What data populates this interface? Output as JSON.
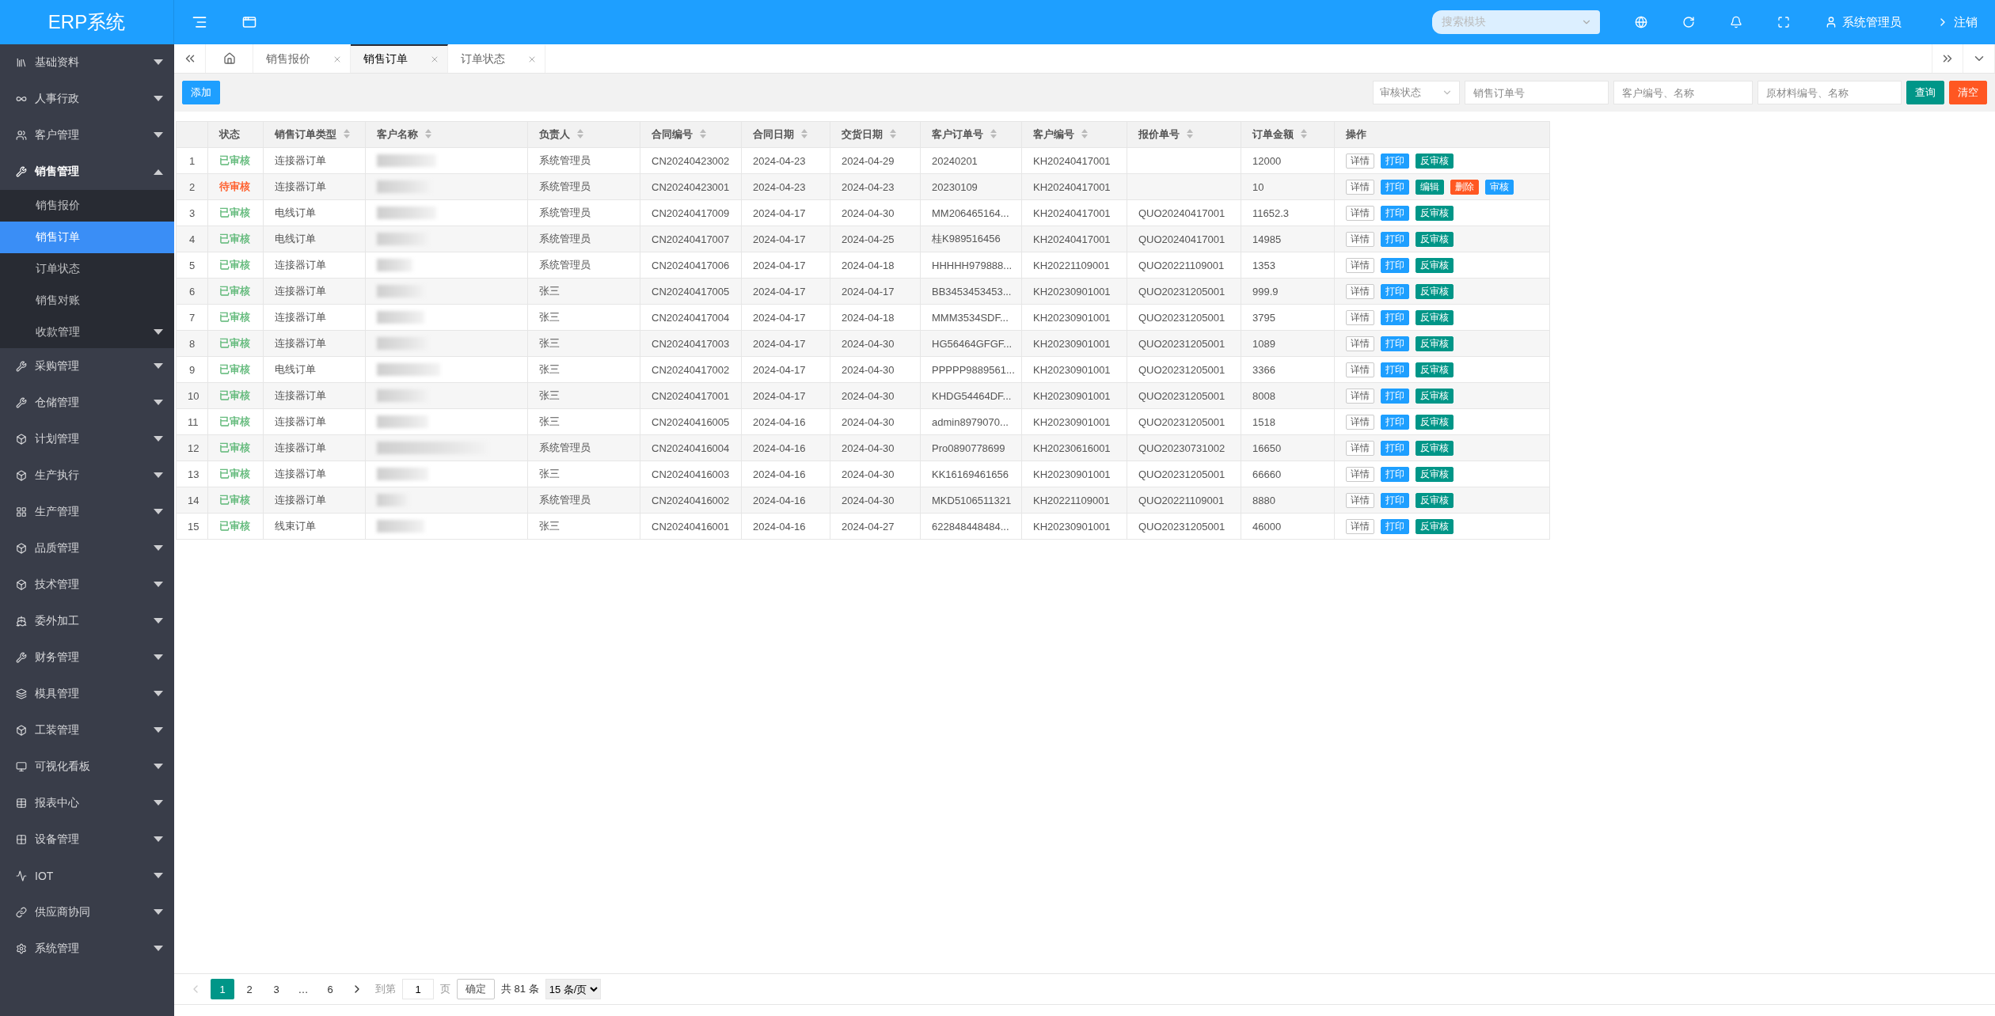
{
  "header": {
    "logo": "ERP系统",
    "search": {
      "placeholder": "搜索模块"
    },
    "user": "系统管理员",
    "logout": "注销"
  },
  "sidebar": {
    "items": [
      {
        "label": "基础资料",
        "expanded": false
      },
      {
        "label": "人事行政",
        "expanded": false
      },
      {
        "label": "客户管理",
        "expanded": false
      },
      {
        "label": "销售管理",
        "expanded": true,
        "children": [
          {
            "label": "销售报价",
            "selected": false
          },
          {
            "label": "销售订单",
            "selected": true
          },
          {
            "label": "订单状态",
            "selected": false
          },
          {
            "label": "销售对账",
            "selected": false
          },
          {
            "label": "收款管理",
            "selected": false,
            "expandable": true
          }
        ]
      },
      {
        "label": "采购管理",
        "expanded": false
      },
      {
        "label": "仓储管理",
        "expanded": false
      },
      {
        "label": "计划管理",
        "expanded": false
      },
      {
        "label": "生产执行",
        "expanded": false
      },
      {
        "label": "生产管理",
        "expanded": false
      },
      {
        "label": "品质管理",
        "expanded": false
      },
      {
        "label": "技术管理",
        "expanded": false
      },
      {
        "label": "委外加工",
        "expanded": false
      },
      {
        "label": "财务管理",
        "expanded": false
      },
      {
        "label": "模具管理",
        "expanded": false
      },
      {
        "label": "工装管理",
        "expanded": false
      },
      {
        "label": "可视化看板",
        "expanded": false
      },
      {
        "label": "报表中心",
        "expanded": false
      },
      {
        "label": "设备管理",
        "expanded": false
      },
      {
        "label": "IOT",
        "expanded": false
      },
      {
        "label": "供应商协同",
        "expanded": false
      },
      {
        "label": "系统管理",
        "expanded": false
      }
    ]
  },
  "tabs": [
    {
      "label": "销售报价",
      "selected": false
    },
    {
      "label": "销售订单",
      "selected": true
    },
    {
      "label": "订单状态",
      "selected": false
    }
  ],
  "toolbar": {
    "add": "添加",
    "filters": [
      {
        "kind": "select",
        "placeholder": "审核状态"
      },
      {
        "kind": "input",
        "placeholder": "销售订单号"
      },
      {
        "kind": "input",
        "placeholder": "客户编号、名称"
      },
      {
        "kind": "input",
        "placeholder": "原材料编号、名称"
      }
    ],
    "query": "查询",
    "clear": "清空"
  },
  "table": {
    "columns": [
      {
        "label": "状态",
        "sortable": false
      },
      {
        "label": "销售订单类型",
        "sortable": true
      },
      {
        "label": "客户名称",
        "sortable": true
      },
      {
        "label": "负责人",
        "sortable": true
      },
      {
        "label": "合同编号",
        "sortable": true
      },
      {
        "label": "合同日期",
        "sortable": true
      },
      {
        "label": "交货日期",
        "sortable": true
      },
      {
        "label": "客户订单号",
        "sortable": true
      },
      {
        "label": "客户编号",
        "sortable": true
      },
      {
        "label": "报价单号",
        "sortable": true
      },
      {
        "label": "订单金额",
        "sortable": true
      },
      {
        "label": "操作",
        "sortable": false
      }
    ],
    "rows": [
      {
        "no": "1",
        "status": "已审核",
        "color": "#5fb878",
        "type": "连接器订单",
        "owner": "系统管理员",
        "contract": "CN20240423002",
        "contract_date": "2024-04-23",
        "delivery_date": "2024-04-29",
        "customer_order": "20240201",
        "customer_code": "KH20240417001",
        "quote": "",
        "amount": "12000",
        "actions": [
          {
            "kind": "detail",
            "label": "详情"
          },
          {
            "kind": "print",
            "label": "打印"
          },
          {
            "kind": "unaudit",
            "label": "反审核"
          }
        ]
      },
      {
        "no": "2",
        "status": "待审核",
        "color": "#ff5722",
        "type": "连接器订单",
        "owner": "系统管理员",
        "contract": "CN20240423001",
        "contract_date": "2024-04-23",
        "delivery_date": "2024-04-23",
        "customer_order": "20230109",
        "customer_code": "KH20240417001",
        "quote": "",
        "amount": "10",
        "actions": [
          {
            "kind": "detail",
            "label": "详情"
          },
          {
            "kind": "print",
            "label": "打印"
          },
          {
            "kind": "edit",
            "label": "编辑"
          },
          {
            "kind": "delete",
            "label": "删除"
          },
          {
            "kind": "audit",
            "label": "审核"
          }
        ]
      },
      {
        "no": "3",
        "status": "已审核",
        "color": "#5fb878",
        "type": "电线订单",
        "owner": "系统管理员",
        "contract": "CN20240417009",
        "contract_date": "2024-04-17",
        "delivery_date": "2024-04-30",
        "customer_order": "MM206465164...",
        "customer_code": "KH20240417001",
        "quote": "QUO20240417001",
        "amount": "11652.3",
        "actions": [
          {
            "kind": "detail",
            "label": "详情"
          },
          {
            "kind": "print",
            "label": "打印"
          },
          {
            "kind": "unaudit",
            "label": "反审核"
          }
        ]
      },
      {
        "no": "4",
        "status": "已审核",
        "color": "#5fb878",
        "type": "电线订单",
        "owner": "系统管理员",
        "contract": "CN20240417007",
        "contract_date": "2024-04-17",
        "delivery_date": "2024-04-25",
        "customer_order": "桂K989516456",
        "customer_code": "KH20240417001",
        "quote": "QUO20240417001",
        "amount": "14985",
        "actions": [
          {
            "kind": "detail",
            "label": "详情"
          },
          {
            "kind": "print",
            "label": "打印"
          },
          {
            "kind": "unaudit",
            "label": "反审核"
          }
        ]
      },
      {
        "no": "5",
        "status": "已审核",
        "color": "#5fb878",
        "type": "连接器订单",
        "owner": "系统管理员",
        "contract": "CN20240417006",
        "contract_date": "2024-04-17",
        "delivery_date": "2024-04-18",
        "customer_order": "HHHHH979888...",
        "customer_code": "KH20221109001",
        "quote": "QUO20221109001",
        "amount": "1353",
        "actions": [
          {
            "kind": "detail",
            "label": "详情"
          },
          {
            "kind": "print",
            "label": "打印"
          },
          {
            "kind": "unaudit",
            "label": "反审核"
          }
        ]
      },
      {
        "no": "6",
        "status": "已审核",
        "color": "#5fb878",
        "type": "连接器订单",
        "owner": "张三",
        "contract": "CN20240417005",
        "contract_date": "2024-04-17",
        "delivery_date": "2024-04-17",
        "customer_order": "BB3453453453...",
        "customer_code": "KH20230901001",
        "quote": "QUO20231205001",
        "amount": "999.9",
        "actions": [
          {
            "kind": "detail",
            "label": "详情"
          },
          {
            "kind": "print",
            "label": "打印"
          },
          {
            "kind": "unaudit",
            "label": "反审核"
          }
        ]
      },
      {
        "no": "7",
        "status": "已审核",
        "color": "#5fb878",
        "type": "连接器订单",
        "owner": "张三",
        "contract": "CN20240417004",
        "contract_date": "2024-04-17",
        "delivery_date": "2024-04-18",
        "customer_order": "MMM3534SDF...",
        "customer_code": "KH20230901001",
        "quote": "QUO20231205001",
        "amount": "3795",
        "actions": [
          {
            "kind": "detail",
            "label": "详情"
          },
          {
            "kind": "print",
            "label": "打印"
          },
          {
            "kind": "unaudit",
            "label": "反审核"
          }
        ]
      },
      {
        "no": "8",
        "status": "已审核",
        "color": "#5fb878",
        "type": "连接器订单",
        "owner": "张三",
        "contract": "CN20240417003",
        "contract_date": "2024-04-17",
        "delivery_date": "2024-04-30",
        "customer_order": "HG56464GFGF...",
        "customer_code": "KH20230901001",
        "quote": "QUO20231205001",
        "amount": "1089",
        "actions": [
          {
            "kind": "detail",
            "label": "详情"
          },
          {
            "kind": "print",
            "label": "打印"
          },
          {
            "kind": "unaudit",
            "label": "反审核"
          }
        ]
      },
      {
        "no": "9",
        "status": "已审核",
        "color": "#5fb878",
        "type": "电线订单",
        "owner": "张三",
        "contract": "CN20240417002",
        "contract_date": "2024-04-17",
        "delivery_date": "2024-04-30",
        "customer_order": "PPPPP9889561...",
        "customer_code": "KH20230901001",
        "quote": "QUO20231205001",
        "amount": "3366",
        "actions": [
          {
            "kind": "detail",
            "label": "详情"
          },
          {
            "kind": "print",
            "label": "打印"
          },
          {
            "kind": "unaudit",
            "label": "反审核"
          }
        ]
      },
      {
        "no": "10",
        "status": "已审核",
        "color": "#5fb878",
        "type": "连接器订单",
        "owner": "张三",
        "contract": "CN20240417001",
        "contract_date": "2024-04-17",
        "delivery_date": "2024-04-30",
        "customer_order": "KHDG54464DF...",
        "customer_code": "KH20230901001",
        "quote": "QUO20231205001",
        "amount": "8008",
        "actions": [
          {
            "kind": "detail",
            "label": "详情"
          },
          {
            "kind": "print",
            "label": "打印"
          },
          {
            "kind": "unaudit",
            "label": "反审核"
          }
        ]
      },
      {
        "no": "11",
        "status": "已审核",
        "color": "#5fb878",
        "type": "连接器订单",
        "owner": "张三",
        "contract": "CN20240416005",
        "contract_date": "2024-04-16",
        "delivery_date": "2024-04-30",
        "customer_order": "admin8979070...",
        "customer_code": "KH20230901001",
        "quote": "QUO20231205001",
        "amount": "1518",
        "actions": [
          {
            "kind": "detail",
            "label": "详情"
          },
          {
            "kind": "print",
            "label": "打印"
          },
          {
            "kind": "unaudit",
            "label": "反审核"
          }
        ]
      },
      {
        "no": "12",
        "status": "已审核",
        "color": "#5fb878",
        "type": "连接器订单",
        "owner": "系统管理员",
        "contract": "CN20240416004",
        "contract_date": "2024-04-16",
        "delivery_date": "2024-04-30",
        "customer_order": "Pro0890778699",
        "customer_code": "KH20230616001",
        "quote": "QUO20230731002",
        "amount": "16650",
        "actions": [
          {
            "kind": "detail",
            "label": "详情"
          },
          {
            "kind": "print",
            "label": "打印"
          },
          {
            "kind": "unaudit",
            "label": "反审核"
          }
        ]
      },
      {
        "no": "13",
        "status": "已审核",
        "color": "#5fb878",
        "type": "连接器订单",
        "owner": "张三",
        "contract": "CN20240416003",
        "contract_date": "2024-04-16",
        "delivery_date": "2024-04-30",
        "customer_order": "KK16169461656",
        "customer_code": "KH20230901001",
        "quote": "QUO20231205001",
        "amount": "66660",
        "actions": [
          {
            "kind": "detail",
            "label": "详情"
          },
          {
            "kind": "print",
            "label": "打印"
          },
          {
            "kind": "unaudit",
            "label": "反审核"
          }
        ]
      },
      {
        "no": "14",
        "status": "已审核",
        "color": "#5fb878",
        "type": "连接器订单",
        "owner": "系统管理员",
        "contract": "CN20240416002",
        "contract_date": "2024-04-16",
        "delivery_date": "2024-04-30",
        "customer_order": "MKD5106511321",
        "customer_code": "KH20221109001",
        "quote": "QUO20221109001",
        "amount": "8880",
        "actions": [
          {
            "kind": "detail",
            "label": "详情"
          },
          {
            "kind": "print",
            "label": "打印"
          },
          {
            "kind": "unaudit",
            "label": "反审核"
          }
        ]
      },
      {
        "no": "15",
        "status": "已审核",
        "color": "#5fb878",
        "type": "线束订单",
        "owner": "张三",
        "contract": "CN20240416001",
        "contract_date": "2024-04-16",
        "delivery_date": "2024-04-27",
        "customer_order": "622848448484...",
        "customer_code": "KH20230901001",
        "quote": "QUO20231205001",
        "amount": "46000",
        "actions": [
          {
            "kind": "detail",
            "label": "详情"
          },
          {
            "kind": "print",
            "label": "打印"
          },
          {
            "kind": "unaudit",
            "label": "反审核"
          }
        ]
      }
    ]
  },
  "pagination": {
    "pages": [
      {
        "label": "1",
        "selected": true
      },
      {
        "label": "2",
        "selected": false
      },
      {
        "label": "3",
        "selected": false
      },
      {
        "label": "…",
        "selected": false
      },
      {
        "label": "6",
        "selected": false
      }
    ],
    "goto_label": "到第",
    "goto_value": "1",
    "page_unit": "页",
    "confirm": "确定",
    "total": "共 81 条",
    "page_size": "15 条/页"
  }
}
